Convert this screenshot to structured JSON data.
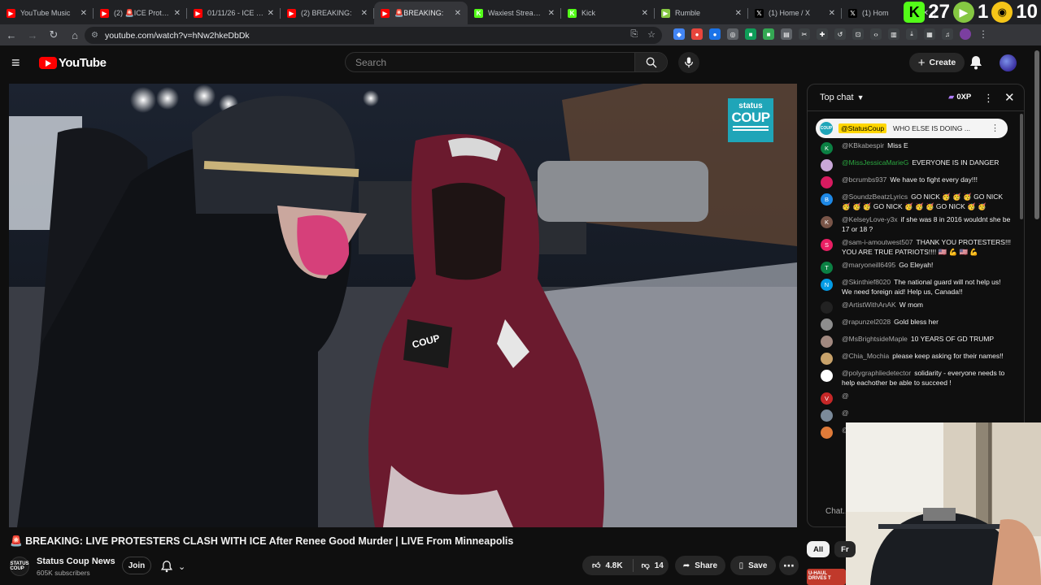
{
  "browser": {
    "tabs": [
      {
        "label": "YouTube Music",
        "color": "#ff0000",
        "icon": "youtube-music-icon",
        "active": false
      },
      {
        "label": "(2) 🚨ICE Protest",
        "color": "#ff0000",
        "icon": "youtube-icon",
        "active": false
      },
      {
        "label": "01/11/26 - ICE Sh",
        "color": "#ff0000",
        "icon": "youtube-icon",
        "active": false
      },
      {
        "label": "(2) BREAKING:",
        "color": "#ff0000",
        "icon": "youtube-icon",
        "active": false
      },
      {
        "label": "🚨BREAKING:",
        "color": "#ff0000",
        "icon": "youtube-icon",
        "active": true
      },
      {
        "label": "Waxiest Stream - V",
        "color": "#53fc18",
        "icon": "kick-icon",
        "active": false
      },
      {
        "label": "Kick",
        "color": "#53fc18",
        "icon": "kick-icon",
        "active": false
      },
      {
        "label": "Rumble",
        "color": "#85c742",
        "icon": "rumble-icon",
        "active": false
      },
      {
        "label": "(1) Home / X",
        "color": "#000000",
        "icon": "x-icon",
        "active": false
      },
      {
        "label": "(1) Hom",
        "color": "#000000",
        "icon": "x-icon",
        "active": false
      }
    ],
    "overlay_numbers": [
      "27",
      "1",
      "10"
    ],
    "url": "youtube.com/watch?v=hNw2hkeDbDk"
  },
  "youtube": {
    "logo_text": "YouTube",
    "search_placeholder": "Search",
    "create_label": "Create"
  },
  "video": {
    "watermark_top": "status",
    "watermark_bottom": "COUP",
    "title_emoji": "🚨",
    "title": "BREAKING: LIVE PROTESTERS CLASH WITH ICE After Renee Good Murder | LIVE From Minneapolis",
    "channel_name": "Status Coup News",
    "channel_avatar_text": "STATUS COUP",
    "subscribers": "605K subscribers",
    "join_label": "Join",
    "likes": "4.8K",
    "dislikes": "14",
    "share_label": "Share",
    "save_label": "Save"
  },
  "chat": {
    "title": "Top chat",
    "xp": "0XP",
    "pinned": {
      "author": "@StatusCoup",
      "text": "WHO ELSE IS DOING ..."
    },
    "messages": [
      {
        "initial": "K",
        "color": "#0b8043",
        "author": "@KBkabespir",
        "member": false,
        "text": "Miss E"
      },
      {
        "initial": "",
        "color": "#c9a7d8",
        "author": "@MissJessicaMarieG",
        "member": true,
        "text": "EVERYONE IS IN DANGER"
      },
      {
        "initial": "",
        "color": "#d81b60",
        "author": "@bcrumbs937",
        "member": false,
        "text": "We have to fight every day!!!"
      },
      {
        "initial": "B",
        "color": "#1e88e5",
        "author": "@SoundzBeatzLyrics",
        "member": false,
        "text": "GO NICK 🥳 🥳 🥳 GO NICK 🥳 🥳 🥳 GO NICK 🥳 🥳 🥳 GO NICK 🥳 🥳"
      },
      {
        "initial": "K",
        "color": "#795548",
        "author": "@KelseyLove-y3x",
        "member": false,
        "text": "if she was 8 in 2016 wouldnt she be 17 or 18 ?"
      },
      {
        "initial": "S",
        "color": "#e91e63",
        "author": "@sam-i-amoutwest507",
        "member": false,
        "text": "THANK YOU PROTESTERS!!! YOU ARE TRUE PATRIOTS!!!! 🇺🇸 💪 🇺🇸 💪"
      },
      {
        "initial": "T",
        "color": "#0b8043",
        "author": "@maryoneill6495",
        "member": false,
        "text": "Go Eleyah!"
      },
      {
        "initial": "N",
        "color": "#039be5",
        "author": "@Skinthief8020",
        "member": false,
        "text": "The national guard will not help us! We need foreign aid! Help us, Canada!!"
      },
      {
        "initial": "",
        "color": "#222222",
        "author": "@ArtistWithAnAK",
        "member": false,
        "text": "W mom"
      },
      {
        "initial": "",
        "color": "#8d8d8d",
        "author": "@rapunzel2028",
        "member": false,
        "text": "Gold bless her"
      },
      {
        "initial": "",
        "color": "#a1887f",
        "author": "@MsBrightsideMaple",
        "member": false,
        "text": "10 YEARS OF GD TRUMP"
      },
      {
        "initial": "",
        "color": "#c8a26a",
        "author": "@Chia_Mochia",
        "member": false,
        "text": "please keep asking for their names!!"
      },
      {
        "initial": "",
        "color": "#ffffff",
        "author": "@polygraphliedetector",
        "member": false,
        "text": "solidarity - everyone needs to help eachother be able to succeed !"
      },
      {
        "initial": "V",
        "color": "#c62828",
        "author": "@",
        "member": false,
        "text": ""
      },
      {
        "initial": "",
        "color": "#7b8a9a",
        "author": "@",
        "member": false,
        "text": ""
      },
      {
        "initial": "",
        "color": "#e07b39",
        "author": "@",
        "member": false,
        "text": ""
      }
    ],
    "input_placeholder": "Chat..."
  },
  "filters": [
    "All",
    "Fr"
  ],
  "thumbnail_text": "U-HAUL DRIVES T"
}
